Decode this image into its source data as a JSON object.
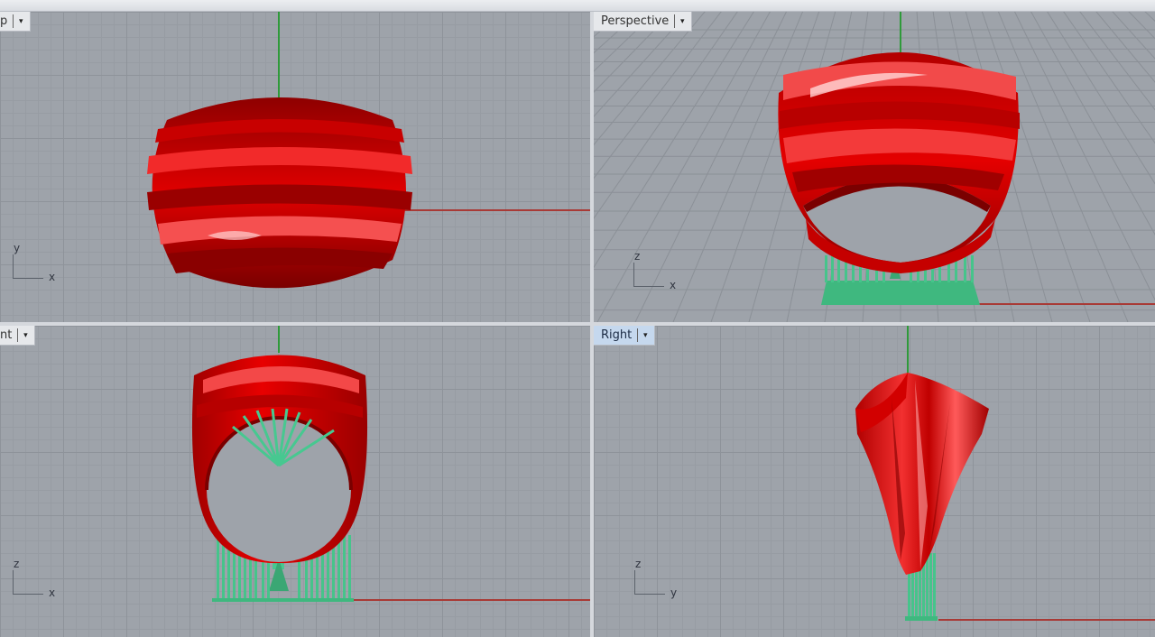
{
  "viewports": {
    "top": {
      "label": "p",
      "axis_v": "y",
      "axis_h": "x"
    },
    "perspective": {
      "label": "Perspective",
      "axis_v": "z",
      "axis_h": "x"
    },
    "front": {
      "label": "nt",
      "axis_v": "z",
      "axis_h": "x"
    },
    "right": {
      "label": "Right",
      "axis_v": "z",
      "axis_h": "y"
    }
  },
  "dropdown_glyph": "▾",
  "colors": {
    "model_red": "#d80000",
    "support_green": "#43c38a",
    "grid_bg": "#9ea3aa",
    "axis_red": "#a83a36",
    "axis_green": "#2f9a3a",
    "active_tab": "#c5d8ee"
  }
}
